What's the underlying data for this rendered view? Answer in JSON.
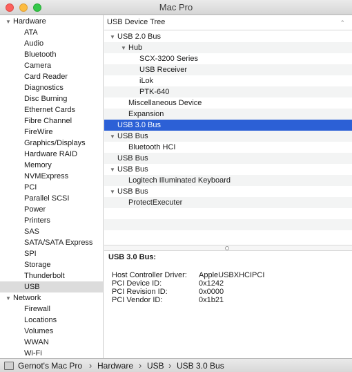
{
  "window": {
    "title": "Mac Pro"
  },
  "sidebar": {
    "rows": [
      {
        "type": "group",
        "label": "Hardware"
      },
      {
        "type": "item",
        "label": "ATA"
      },
      {
        "type": "item",
        "label": "Audio"
      },
      {
        "type": "item",
        "label": "Bluetooth"
      },
      {
        "type": "item",
        "label": "Camera"
      },
      {
        "type": "item",
        "label": "Card Reader"
      },
      {
        "type": "item",
        "label": "Diagnostics"
      },
      {
        "type": "item",
        "label": "Disc Burning"
      },
      {
        "type": "item",
        "label": "Ethernet Cards"
      },
      {
        "type": "item",
        "label": "Fibre Channel"
      },
      {
        "type": "item",
        "label": "FireWire"
      },
      {
        "type": "item",
        "label": "Graphics/Displays"
      },
      {
        "type": "item",
        "label": "Hardware RAID"
      },
      {
        "type": "item",
        "label": "Memory"
      },
      {
        "type": "item",
        "label": "NVMExpress"
      },
      {
        "type": "item",
        "label": "PCI"
      },
      {
        "type": "item",
        "label": "Parallel SCSI"
      },
      {
        "type": "item",
        "label": "Power"
      },
      {
        "type": "item",
        "label": "Printers"
      },
      {
        "type": "item",
        "label": "SAS"
      },
      {
        "type": "item",
        "label": "SATA/SATA Express"
      },
      {
        "type": "item",
        "label": "SPI"
      },
      {
        "type": "item",
        "label": "Storage"
      },
      {
        "type": "item",
        "label": "Thunderbolt"
      },
      {
        "type": "item",
        "label": "USB",
        "selected": true
      },
      {
        "type": "group",
        "label": "Network"
      },
      {
        "type": "item",
        "label": "Firewall"
      },
      {
        "type": "item",
        "label": "Locations"
      },
      {
        "type": "item",
        "label": "Volumes"
      },
      {
        "type": "item",
        "label": "WWAN"
      },
      {
        "type": "item",
        "label": "Wi-Fi"
      }
    ]
  },
  "device_tree": {
    "header": "USB Device Tree",
    "rows": [
      {
        "label": "USB 2.0 Bus",
        "level": 0,
        "expandable": true
      },
      {
        "label": "Hub",
        "level": 1,
        "expandable": true
      },
      {
        "label": "SCX-3200 Series",
        "level": 3
      },
      {
        "label": "USB Receiver",
        "level": 3
      },
      {
        "label": "iLok",
        "level": 3
      },
      {
        "label": "PTK-640",
        "level": 3
      },
      {
        "label": "Miscellaneous Device",
        "level": 2
      },
      {
        "label": "Expansion",
        "level": 2
      },
      {
        "label": "USB 3.0 Bus",
        "level": 0,
        "selected": true
      },
      {
        "label": "USB Bus",
        "level": 0,
        "expandable": true
      },
      {
        "label": "Bluetooth HCI",
        "level": 2
      },
      {
        "label": "USB Bus",
        "level": 0
      },
      {
        "label": "USB Bus",
        "level": 0,
        "expandable": true
      },
      {
        "label": "Logitech Illuminated Keyboard",
        "level": 2
      },
      {
        "label": "USB Bus",
        "level": 0,
        "expandable": true
      },
      {
        "label": "ProtectExecuter",
        "level": 2
      }
    ]
  },
  "details": {
    "title": "USB 3.0 Bus:",
    "fields": [
      {
        "key": "Host Controller Driver:",
        "value": "AppleUSBXHCIPCI"
      },
      {
        "key": "PCI Device ID:",
        "value": "0x1242"
      },
      {
        "key": "PCI Revision ID:",
        "value": "0x0000"
      },
      {
        "key": "PCI Vendor ID:",
        "value": "0x1b21"
      }
    ]
  },
  "status_bar": {
    "breadcrumbs": [
      "Gernot's Mac Pro",
      "Hardware",
      "USB",
      "USB 3.0 Bus"
    ]
  },
  "colors": {
    "selection_blue": "#2c60d6",
    "sidebar_selection": "#dcdcdc"
  }
}
